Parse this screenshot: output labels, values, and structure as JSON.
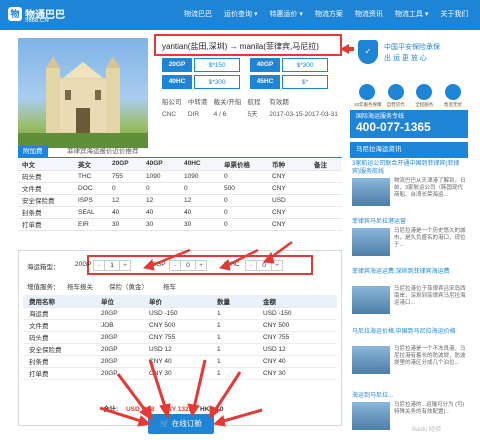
{
  "header": {
    "logo_cn": "物通巴巴",
    "logo_en": "5688.CN",
    "nav": [
      "物流巴巴",
      "运价查询 ▾",
      "特惠运价 ▾",
      "物流方案",
      "物流资讯",
      "物流工具 ▾",
      "关于我们"
    ]
  },
  "product": {
    "route": "yantian(盐田,深圳) → manila(菲律宾,马尼拉)",
    "prices": [
      {
        "type": "20GP",
        "value": "$*150"
      },
      {
        "type": "40GP",
        "value": "$*300"
      },
      {
        "type": "40HC",
        "value": "$*300"
      },
      {
        "type": "45HC",
        "value": "$*"
      }
    ],
    "info_labels": [
      "船公司",
      "中转港",
      "截关/开船",
      "航程",
      "有效期"
    ],
    "info_values": [
      "CNC",
      "DIR",
      "4 / 6",
      "5天",
      "2017-03-15-2017-03-31"
    ]
  },
  "guarantee": {
    "title": "中国平安保险承保",
    "subtitle": "出 运 更 放 心",
    "icons": [
      "10年服务保障",
      "自营货代",
      "全程服务",
      "售后无忧"
    ]
  },
  "hotline": {
    "title": "国际海运服务专线",
    "number": "400-077-1365"
  },
  "news": {
    "header": "马尼拉海运资讯",
    "items": [
      {
        "title": "3家航运公司联合开通中国到菲律宾(菲律宾)服务航线",
        "text": "物流巴巴从天津港了解到，日前，3家航运公司（韩国现代商船、台湾长荣海运..."
      },
      {
        "title": "菲律宾马尼拉港运营",
        "text": "马尼拉港是一个历史悠久的城市，是久负盛名的港口，现位于..."
      },
      {
        "title": "菲律宾海运运费,深圳到菲律宾海运费",
        "text": "马尼拉港位于菲律宾吕宋岛西南岸，深圳到菲律宾马尼拉海运港口..."
      },
      {
        "title": "马尼拉海运价格,中国到马尼拉海运价格",
        "text": "马尼拉港是一个不冻良港，马尼拉港有着长的防波堤，防波堤里的港区分成几个泊位..."
      },
      {
        "title": "海运到马尼拉...",
        "text": "马尼拉港的...运输可分为 (可)特殊关务的有效配置)..."
      }
    ]
  },
  "tabs": {
    "active": "附加费",
    "inactive": "菲律宾海运报价近价推荐"
  },
  "fees": {
    "columns": [
      "中文",
      "英文",
      "20GP",
      "40GP",
      "40HC",
      "单票价格",
      "币种",
      "备注"
    ],
    "rows": [
      [
        "码头费",
        "THC",
        "755",
        "1090",
        "1090",
        "0",
        "CNY",
        ""
      ],
      [
        "文件费",
        "DOC",
        "0",
        "0",
        "0",
        "500",
        "CNY",
        ""
      ],
      [
        "安全保险费",
        "ISPS",
        "12",
        "12",
        "12",
        "0",
        "USD",
        ""
      ],
      [
        "封条费",
        "SEAL",
        "40",
        "40",
        "40",
        "0",
        "CNY",
        ""
      ],
      [
        "打单费",
        "EIR",
        "30",
        "30",
        "30",
        "0",
        "CNY",
        ""
      ]
    ]
  },
  "booking": {
    "count_label": "海运箱型：",
    "steppers": [
      {
        "label": "20GP",
        "value": "1"
      },
      {
        "label": "40GP",
        "value": "0"
      },
      {
        "label": "40HC",
        "value": "0"
      }
    ],
    "insurance_label": "增值服务：",
    "options": [
      "拖车报关",
      "保险（黄金）",
      "拖车"
    ],
    "order_columns": [
      "费用名称",
      "单位",
      "单价",
      "数量",
      "金额"
    ],
    "order_rows": [
      [
        "海运费",
        "20GP",
        "USD -150",
        "1",
        "USD -150"
      ],
      [
        "文件费",
        "JOB",
        "CNY 500",
        "1",
        "CNY 500"
      ],
      [
        "码头费",
        "20GP",
        "CNY 755",
        "1",
        "CNY 755"
      ],
      [
        "安全保险费",
        "20GP",
        "USD 12",
        "1",
        "USD 12"
      ],
      [
        "封条费",
        "20GP",
        "CNY 40",
        "1",
        "CNY 40"
      ],
      [
        "打单费",
        "20GP",
        "CNY 30",
        "1",
        "CNY 30"
      ]
    ],
    "totals": {
      "label": "合计:",
      "usd": "USD -138",
      "cny": "CNY 1325",
      "hkd": "HKD : 0"
    },
    "book_button": "在线订舱"
  },
  "watermark": "Baidu 经验",
  "colors": {
    "primary": "#1e84d6",
    "highlight": "#e53935"
  }
}
